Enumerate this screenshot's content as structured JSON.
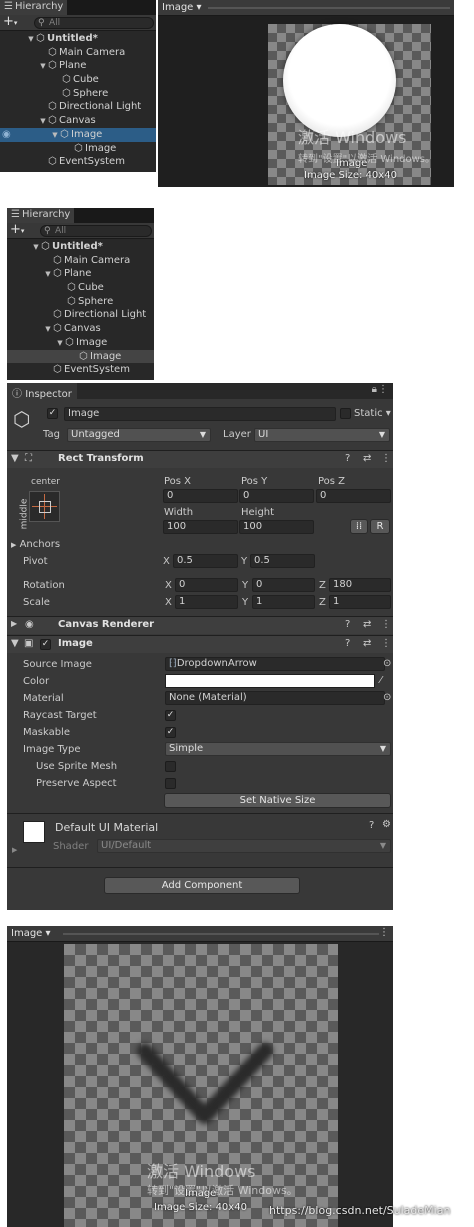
{
  "hierarchy_top": {
    "tab_label": "Hierarchy",
    "search_placeholder": "All",
    "rows": [
      {
        "label": "Untitled*"
      },
      {
        "label": "Main Camera"
      },
      {
        "label": "Plane"
      },
      {
        "label": "Cube"
      },
      {
        "label": "Sphere"
      },
      {
        "label": "Directional Light"
      },
      {
        "label": "Canvas"
      },
      {
        "label": "Image"
      },
      {
        "label": "Image"
      },
      {
        "label": "EventSystem"
      }
    ]
  },
  "game_view_top": {
    "dropdown_label": "Image",
    "watermark_line1": "激活 Windows",
    "watermark_line2": "转到\"设置\"以激活 Windows。",
    "image_name": "Image",
    "image_size": "Image Size: 40x40"
  },
  "hierarchy_bottom": {
    "tab_label": "Hierarchy",
    "search_placeholder": "All",
    "rows": [
      {
        "label": "Untitled*"
      },
      {
        "label": "Main Camera"
      },
      {
        "label": "Plane"
      },
      {
        "label": "Cube"
      },
      {
        "label": "Sphere"
      },
      {
        "label": "Directional Light"
      },
      {
        "label": "Canvas"
      },
      {
        "label": "Image"
      },
      {
        "label": "Image"
      },
      {
        "label": "EventSystem"
      }
    ]
  },
  "inspector": {
    "tab_label": "Inspector",
    "object_name": "Image",
    "static_label": "Static",
    "tag_label": "Tag",
    "tag_value": "Untagged",
    "layer_label": "Layer",
    "layer_value": "UI",
    "rect_transform": {
      "title": "Rect Transform",
      "anchor_h": "center",
      "anchor_v": "middle",
      "posx_label": "Pos X",
      "posx": "0",
      "posy_label": "Pos Y",
      "posy": "0",
      "posz_label": "Pos Z",
      "posz": "0",
      "width_label": "Width",
      "width": "100",
      "height_label": "Height",
      "height": "100",
      "raw_edit": "R",
      "anchors_label": "Anchors",
      "pivot_label": "Pivot",
      "pivot_x": "0.5",
      "pivot_y": "0.5",
      "rotation_label": "Rotation",
      "rot_x": "0",
      "rot_y": "0",
      "rot_z": "180",
      "scale_label": "Scale",
      "scale_x": "1",
      "scale_y": "1",
      "scale_z": "1",
      "x": "X",
      "y": "Y",
      "z": "Z"
    },
    "canvas_renderer": {
      "title": "Canvas Renderer"
    },
    "image": {
      "title": "Image",
      "source_image_label": "Source Image",
      "source_image_value": "DropdownArrow",
      "color_label": "Color",
      "material_label": "Material",
      "material_value": "None (Material)",
      "raycast_label": "Raycast Target",
      "maskable_label": "Maskable",
      "image_type_label": "Image Type",
      "image_type_value": "Simple",
      "use_sprite_mesh_label": "Use Sprite Mesh",
      "preserve_aspect_label": "Preserve Aspect",
      "set_native_size": "Set Native Size"
    },
    "material": {
      "name": "Default UI Material",
      "shader_label": "Shader",
      "shader_value": "UI/Default"
    },
    "add_component": "Add Component"
  },
  "game_view_bottom": {
    "dropdown_label": "Image",
    "watermark_line1": "激活 Windows",
    "watermark_line2": "转到\"设置\"以激活 Windows。",
    "image_name": "Image",
    "image_size": "Image Size: 40x40",
    "url": "https://blog.csdn.net/SuladeMian"
  },
  "colors": {
    "selection": "#2c5d87",
    "panel": "#282828",
    "inspector_bg": "#383838"
  }
}
